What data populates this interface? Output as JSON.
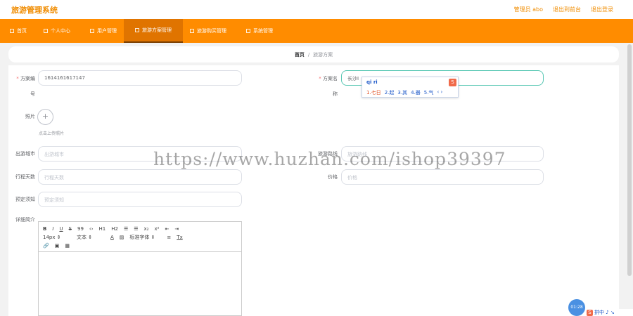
{
  "header": {
    "brand": "旅游管理系统",
    "user": "管理员 abo",
    "exit_admin": "退出到前台",
    "logout": "退出登录"
  },
  "nav": [
    {
      "label": "首页",
      "icon": "home-icon"
    },
    {
      "label": "个人中心",
      "icon": "person-icon"
    },
    {
      "label": "用户管理",
      "icon": "users-icon"
    },
    {
      "label": "旅游方案管理",
      "icon": "plan-icon",
      "active": true
    },
    {
      "label": "旅游购买管理",
      "icon": "cart-icon"
    },
    {
      "label": "系统管理",
      "icon": "settings-icon"
    }
  ],
  "breadcrumb": {
    "home": "首页",
    "sep": "/",
    "current": "旅游方案"
  },
  "form": {
    "plan_no_label_1": "方案编",
    "plan_no_label_2": "号",
    "plan_no_value": "1614161617147",
    "plan_name_label_1": "方案名",
    "plan_name_label_2": "称",
    "plan_name_value": "长沙I",
    "photo_label": "照片",
    "upload_plus": "+",
    "upload_hint": "点击上传照片",
    "city_label": "出游城市",
    "city_placeholder": "出游城市",
    "route_label": "旅游路线",
    "route_placeholder": "旅游路线",
    "days_label": "行程天数",
    "days_placeholder": "行程天数",
    "price_label": "价格",
    "price_placeholder": "价格",
    "notice_label": "预定须知",
    "notice_placeholder": "预定须知",
    "detail_label": "详细简介",
    "required_mark": "*"
  },
  "ime": {
    "composition": "qi ri",
    "candidates": [
      "1.七日",
      "2.起",
      "3.其",
      "4.器",
      "5.气"
    ],
    "nav": "‹ ›",
    "logo": "S"
  },
  "editor": {
    "row1": [
      "B",
      "I",
      "U",
      "S",
      "99",
      "‹›",
      "H1",
      "H2",
      "☰",
      "☰",
      "x₂",
      "x²",
      "⇤",
      "⇥"
    ],
    "row2": [
      "14px ⇕",
      "文本 ⇕",
      "A",
      "▨",
      "标准字体 ⇕",
      "≡",
      "Tx"
    ],
    "row3": [
      "🔗",
      "▣",
      "▦"
    ]
  },
  "watermark": "https://www.huzhan.com/ishop39397",
  "backtop": "01:28",
  "tray": {
    "logo": "S",
    "text": "拼中 ♪ ↘"
  }
}
